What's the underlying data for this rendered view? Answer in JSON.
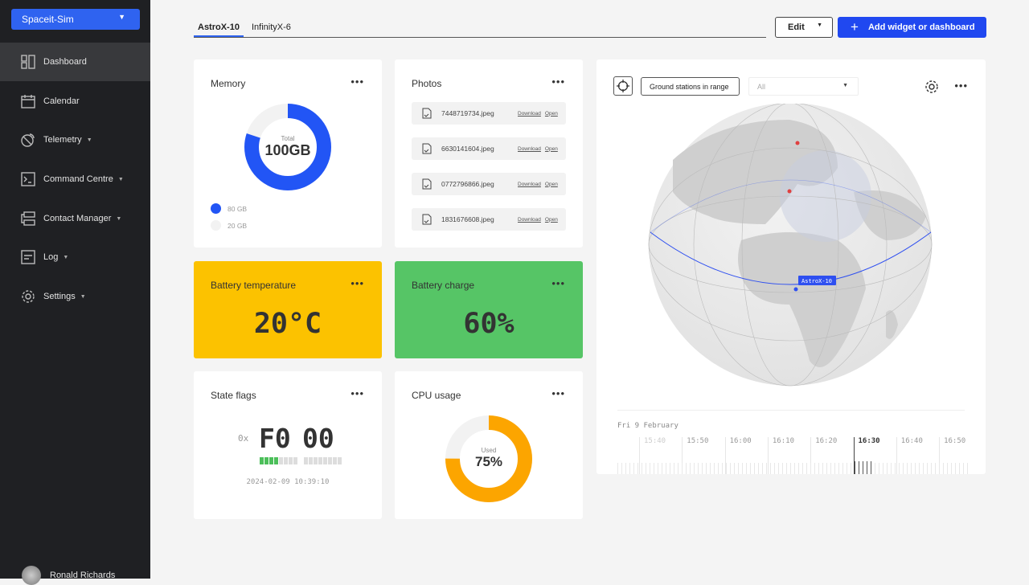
{
  "sidebar": {
    "org": "Spaceit-Sim",
    "items": [
      {
        "label": "Dashboard",
        "icon": "dashboard-icon"
      },
      {
        "label": "Calendar",
        "icon": "calendar-icon"
      },
      {
        "label": "Telemetry",
        "icon": "satellite-dish-icon"
      },
      {
        "label": "Command Centre",
        "icon": "terminal-icon"
      },
      {
        "label": "Contact Manager",
        "icon": "contact-manager-icon"
      },
      {
        "label": "Log",
        "icon": "log-icon"
      },
      {
        "label": "Settings",
        "icon": "gear-icon"
      }
    ],
    "user": "Ronald Richards"
  },
  "header": {
    "tabs": [
      "AstroX-10",
      "InfinityX-6"
    ],
    "edit": "Edit",
    "add": "Add widget or dashboard"
  },
  "memory": {
    "title": "Memory",
    "total_label": "Total",
    "total": "100GB",
    "legend": [
      {
        "label": "80 GB",
        "color": "#2255f5"
      },
      {
        "label": "20 GB",
        "color": "#f2f2f2"
      }
    ],
    "used_fraction": 0.8
  },
  "photos": {
    "title": "Photos",
    "download": "Download",
    "open": "Open",
    "files": [
      "7448719734.jpeg",
      "6630141604.jpeg",
      "0772796866.jpeg",
      "1831676608.jpeg"
    ]
  },
  "battery_temp": {
    "title": "Battery temperature",
    "value": "20°C",
    "color": "#fcc200"
  },
  "battery_charge": {
    "title": "Battery charge",
    "value": "60%",
    "color": "#56c566"
  },
  "state_flags": {
    "title": "State flags",
    "prefix": "0x",
    "byte1": "F0",
    "byte2": "00",
    "bits1": [
      1,
      1,
      1,
      1,
      0,
      0,
      0,
      0
    ],
    "bits2": [
      0,
      0,
      0,
      0,
      0,
      0,
      0,
      0
    ],
    "timestamp": "2024-02-09 10:39:10"
  },
  "cpu": {
    "title": "CPU usage",
    "used_label": "Used",
    "value": "75%",
    "fraction": 0.75,
    "color": "#fca500"
  },
  "map": {
    "ground_stations": "Ground stations in range",
    "filter": "All",
    "satellite": "AstroX-10",
    "date": "Fri 9 February",
    "times": [
      "15:40",
      "15:50",
      "16:00",
      "16:10",
      "16:20",
      "16:30",
      "16:40",
      "16:50"
    ],
    "current_time": "16:30"
  }
}
